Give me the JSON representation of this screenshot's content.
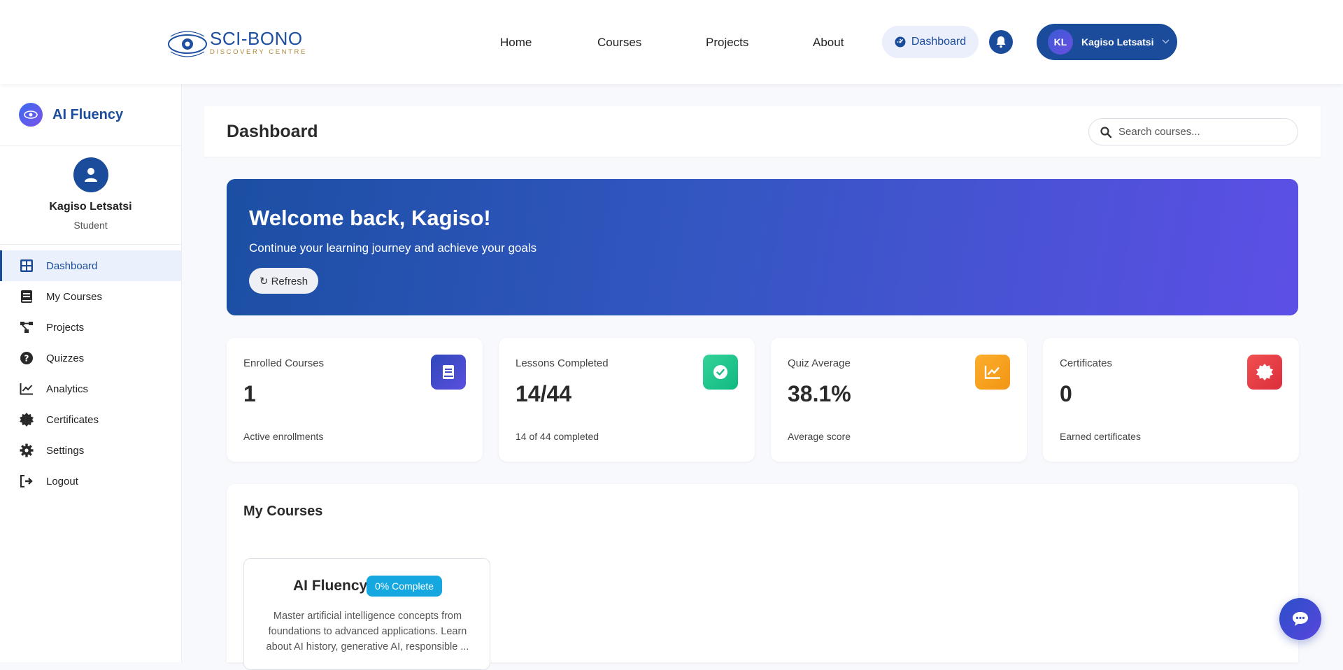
{
  "brand": {
    "title": "SCI-BONO",
    "subtitle": "DISCOVERY CENTRE"
  },
  "nav": {
    "links": [
      "Home",
      "Courses",
      "Projects",
      "About"
    ],
    "dashboard_label": "Dashboard",
    "user_initials": "KL",
    "user_name": "Kagiso Letsatsi"
  },
  "sidebar": {
    "app_title": "AI Fluency",
    "profile": {
      "name": "Kagiso Letsatsi",
      "role": "Student"
    },
    "items": [
      {
        "label": "Dashboard",
        "icon": "grid-icon"
      },
      {
        "label": "My Courses",
        "icon": "book-icon"
      },
      {
        "label": "Projects",
        "icon": "project-diagram-icon"
      },
      {
        "label": "Quizzes",
        "icon": "question-circle-icon"
      },
      {
        "label": "Analytics",
        "icon": "chart-line-icon"
      },
      {
        "label": "Certificates",
        "icon": "certificate-icon"
      },
      {
        "label": "Settings",
        "icon": "gear-icon"
      },
      {
        "label": "Logout",
        "icon": "logout-icon"
      }
    ]
  },
  "header": {
    "title": "Dashboard",
    "search_placeholder": "Search courses..."
  },
  "welcome": {
    "title": "Welcome back, Kagiso!",
    "subtitle": "Continue your learning journey and achieve your goals",
    "refresh_label": "↻ Refresh"
  },
  "stats": [
    {
      "label": "Enrolled Courses",
      "value": "1",
      "sub": "Active enrollments",
      "color": "#3f4fc8",
      "icon": "book-icon"
    },
    {
      "label": "Lessons Completed",
      "value": "14/44",
      "sub": "14 of 44 completed",
      "color": "#2ecc8a",
      "icon": "check-circle-icon"
    },
    {
      "label": "Quiz Average",
      "value": "38.1%",
      "sub": "Average score",
      "color": "#f59e1b",
      "icon": "chart-line-icon"
    },
    {
      "label": "Certificates",
      "value": "0",
      "sub": "Earned certificates",
      "color": "#e53e4a",
      "icon": "certificate-icon"
    }
  ],
  "courses": {
    "title": "My Courses",
    "items": [
      {
        "title": "AI Fluency",
        "badge": "0% Complete",
        "description": "Master artificial intelligence concepts from foundations to advanced applications. Learn about AI history, generative AI, responsible ..."
      }
    ]
  },
  "colors": {
    "primary": "#1b4c9c",
    "accent": "#5d4fe6"
  }
}
